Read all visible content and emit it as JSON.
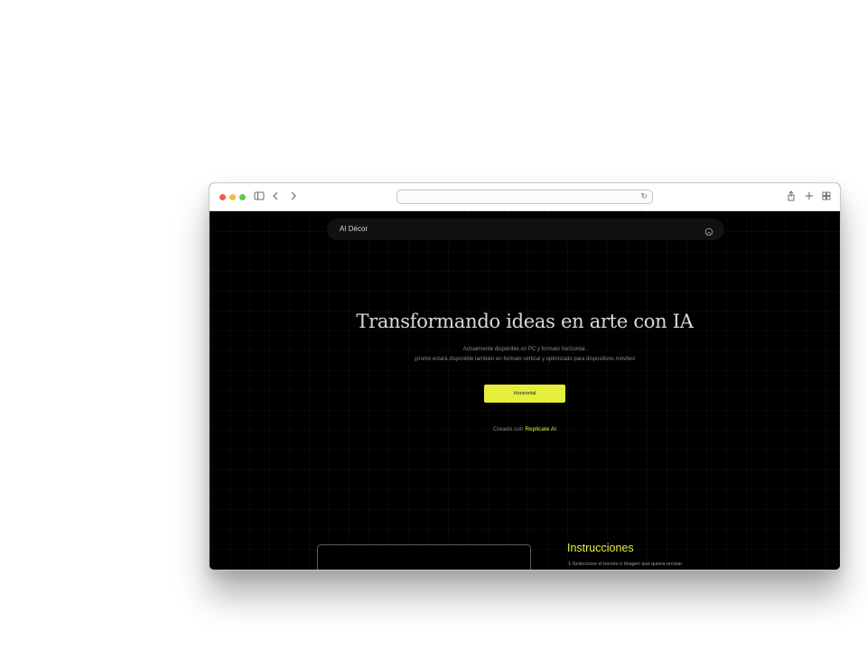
{
  "browser": {
    "address": "",
    "icons": {
      "sidebar": "sidebar-icon",
      "back": "chevron-left-icon",
      "forward": "chevron-right-icon",
      "reload": "reload-icon",
      "share": "share-icon",
      "new_tab": "plus-icon",
      "tab_overview": "tab-grid-icon"
    },
    "traffic_lights": [
      "#ee5e57",
      "#f4bd35",
      "#5ec84a"
    ]
  },
  "navbar": {
    "brand": "AI Décor",
    "icon": "github-icon"
  },
  "hero": {
    "title": "Transformando ideas en arte con IA",
    "subtitle_line1": "Actualmente disponible en PC y formato horizontal.",
    "subtitle_line2": "¡pronto estará disponible también en formato vertical y optimizado para dispositivos móviles!",
    "cta_label": "Horizontal",
    "credit_prefix": "Creado con",
    "credit_link": "Replicate AI"
  },
  "instructions": {
    "title": "Instrucciones",
    "steps": [
      "1-Seleccione el boceto o imagen que quiera recrear"
    ]
  },
  "colors": {
    "accent": "#e6ee3c",
    "background": "#000000",
    "navbar": "#111113"
  }
}
